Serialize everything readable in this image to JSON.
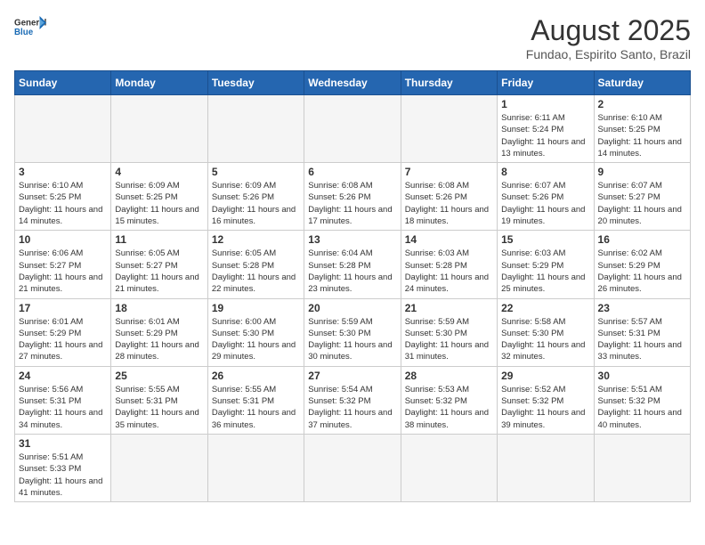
{
  "header": {
    "logo_general": "General",
    "logo_blue": "Blue",
    "month_title": "August 2025",
    "subtitle": "Fundao, Espirito Santo, Brazil"
  },
  "weekdays": [
    "Sunday",
    "Monday",
    "Tuesday",
    "Wednesday",
    "Thursday",
    "Friday",
    "Saturday"
  ],
  "days": [
    {
      "date": null,
      "number": "",
      "info": ""
    },
    {
      "date": null,
      "number": "",
      "info": ""
    },
    {
      "date": null,
      "number": "",
      "info": ""
    },
    {
      "date": null,
      "number": "",
      "info": ""
    },
    {
      "date": null,
      "number": "",
      "info": ""
    },
    {
      "date": 1,
      "number": "1",
      "info": "Sunrise: 6:11 AM\nSunset: 5:24 PM\nDaylight: 11 hours and 13 minutes."
    },
    {
      "date": 2,
      "number": "2",
      "info": "Sunrise: 6:10 AM\nSunset: 5:25 PM\nDaylight: 11 hours and 14 minutes."
    },
    {
      "date": 3,
      "number": "3",
      "info": "Sunrise: 6:10 AM\nSunset: 5:25 PM\nDaylight: 11 hours and 14 minutes."
    },
    {
      "date": 4,
      "number": "4",
      "info": "Sunrise: 6:09 AM\nSunset: 5:25 PM\nDaylight: 11 hours and 15 minutes."
    },
    {
      "date": 5,
      "number": "5",
      "info": "Sunrise: 6:09 AM\nSunset: 5:26 PM\nDaylight: 11 hours and 16 minutes."
    },
    {
      "date": 6,
      "number": "6",
      "info": "Sunrise: 6:08 AM\nSunset: 5:26 PM\nDaylight: 11 hours and 17 minutes."
    },
    {
      "date": 7,
      "number": "7",
      "info": "Sunrise: 6:08 AM\nSunset: 5:26 PM\nDaylight: 11 hours and 18 minutes."
    },
    {
      "date": 8,
      "number": "8",
      "info": "Sunrise: 6:07 AM\nSunset: 5:26 PM\nDaylight: 11 hours and 19 minutes."
    },
    {
      "date": 9,
      "number": "9",
      "info": "Sunrise: 6:07 AM\nSunset: 5:27 PM\nDaylight: 11 hours and 20 minutes."
    },
    {
      "date": 10,
      "number": "10",
      "info": "Sunrise: 6:06 AM\nSunset: 5:27 PM\nDaylight: 11 hours and 21 minutes."
    },
    {
      "date": 11,
      "number": "11",
      "info": "Sunrise: 6:05 AM\nSunset: 5:27 PM\nDaylight: 11 hours and 21 minutes."
    },
    {
      "date": 12,
      "number": "12",
      "info": "Sunrise: 6:05 AM\nSunset: 5:28 PM\nDaylight: 11 hours and 22 minutes."
    },
    {
      "date": 13,
      "number": "13",
      "info": "Sunrise: 6:04 AM\nSunset: 5:28 PM\nDaylight: 11 hours and 23 minutes."
    },
    {
      "date": 14,
      "number": "14",
      "info": "Sunrise: 6:03 AM\nSunset: 5:28 PM\nDaylight: 11 hours and 24 minutes."
    },
    {
      "date": 15,
      "number": "15",
      "info": "Sunrise: 6:03 AM\nSunset: 5:29 PM\nDaylight: 11 hours and 25 minutes."
    },
    {
      "date": 16,
      "number": "16",
      "info": "Sunrise: 6:02 AM\nSunset: 5:29 PM\nDaylight: 11 hours and 26 minutes."
    },
    {
      "date": 17,
      "number": "17",
      "info": "Sunrise: 6:01 AM\nSunset: 5:29 PM\nDaylight: 11 hours and 27 minutes."
    },
    {
      "date": 18,
      "number": "18",
      "info": "Sunrise: 6:01 AM\nSunset: 5:29 PM\nDaylight: 11 hours and 28 minutes."
    },
    {
      "date": 19,
      "number": "19",
      "info": "Sunrise: 6:00 AM\nSunset: 5:30 PM\nDaylight: 11 hours and 29 minutes."
    },
    {
      "date": 20,
      "number": "20",
      "info": "Sunrise: 5:59 AM\nSunset: 5:30 PM\nDaylight: 11 hours and 30 minutes."
    },
    {
      "date": 21,
      "number": "21",
      "info": "Sunrise: 5:59 AM\nSunset: 5:30 PM\nDaylight: 11 hours and 31 minutes."
    },
    {
      "date": 22,
      "number": "22",
      "info": "Sunrise: 5:58 AM\nSunset: 5:30 PM\nDaylight: 11 hours and 32 minutes."
    },
    {
      "date": 23,
      "number": "23",
      "info": "Sunrise: 5:57 AM\nSunset: 5:31 PM\nDaylight: 11 hours and 33 minutes."
    },
    {
      "date": 24,
      "number": "24",
      "info": "Sunrise: 5:56 AM\nSunset: 5:31 PM\nDaylight: 11 hours and 34 minutes."
    },
    {
      "date": 25,
      "number": "25",
      "info": "Sunrise: 5:55 AM\nSunset: 5:31 PM\nDaylight: 11 hours and 35 minutes."
    },
    {
      "date": 26,
      "number": "26",
      "info": "Sunrise: 5:55 AM\nSunset: 5:31 PM\nDaylight: 11 hours and 36 minutes."
    },
    {
      "date": 27,
      "number": "27",
      "info": "Sunrise: 5:54 AM\nSunset: 5:32 PM\nDaylight: 11 hours and 37 minutes."
    },
    {
      "date": 28,
      "number": "28",
      "info": "Sunrise: 5:53 AM\nSunset: 5:32 PM\nDaylight: 11 hours and 38 minutes."
    },
    {
      "date": 29,
      "number": "29",
      "info": "Sunrise: 5:52 AM\nSunset: 5:32 PM\nDaylight: 11 hours and 39 minutes."
    },
    {
      "date": 30,
      "number": "30",
      "info": "Sunrise: 5:51 AM\nSunset: 5:32 PM\nDaylight: 11 hours and 40 minutes."
    },
    {
      "date": 31,
      "number": "31",
      "info": "Sunrise: 5:51 AM\nSunset: 5:33 PM\nDaylight: 11 hours and 41 minutes."
    }
  ]
}
